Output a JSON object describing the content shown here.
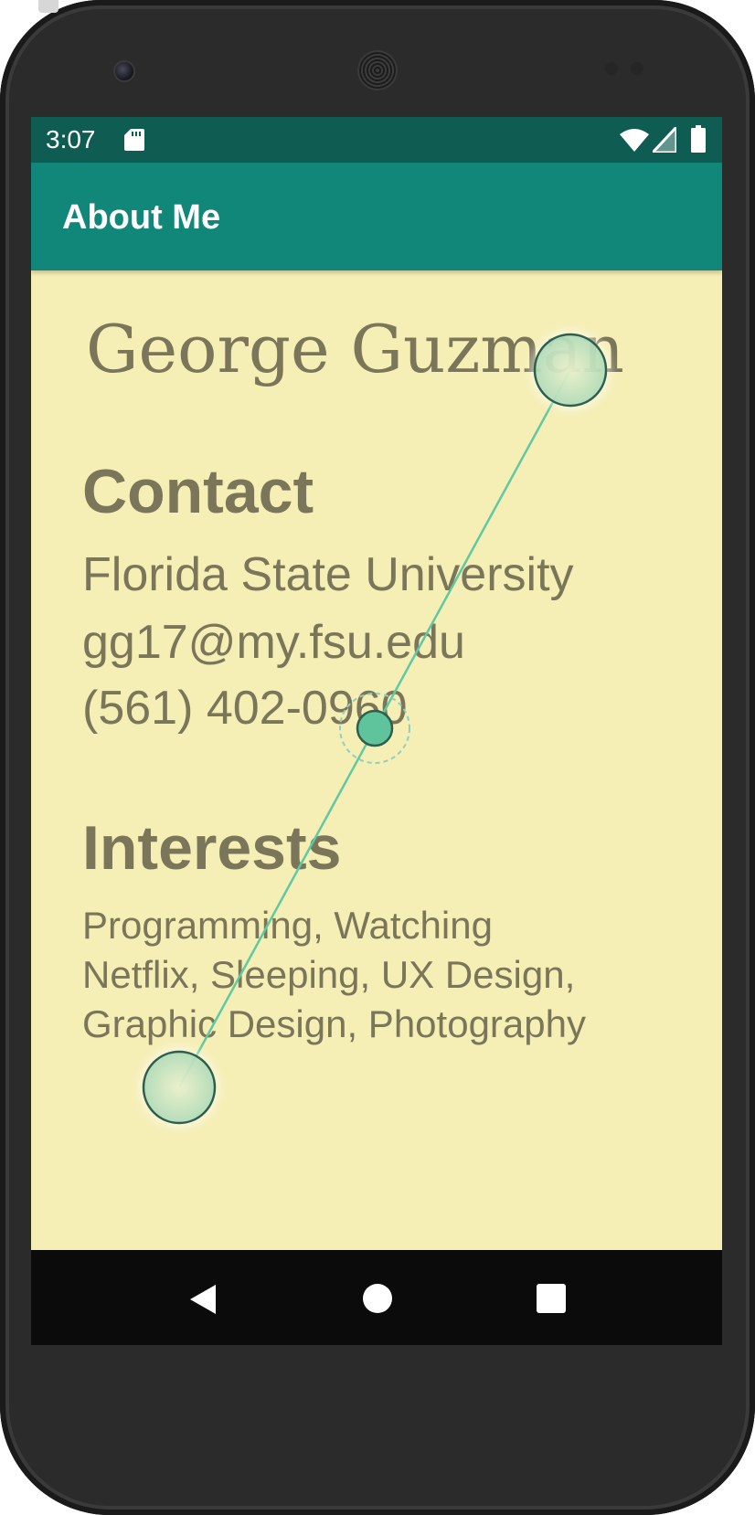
{
  "status_bar": {
    "time": "3:07",
    "icons": [
      "sd-card-icon",
      "wifi-icon",
      "cell-signal-icon",
      "battery-icon"
    ]
  },
  "app_bar": {
    "title": "About Me"
  },
  "profile": {
    "name": "George Guzman"
  },
  "contact": {
    "heading": "Contact",
    "school": "Florida State University",
    "email": "gg17@my.fsu.edu",
    "phone": "(561) 402-0960"
  },
  "interests": {
    "heading": "Interests",
    "text": "Programming, Watching Netflix, Sleeping, UX Design, Graphic Design, Photography"
  },
  "navigation": {
    "icons": [
      "back-icon",
      "home-icon",
      "recents-icon"
    ]
  },
  "colors": {
    "status_bar": "#0f5c52",
    "app_bar": "#11877a",
    "background": "#f5eeb5",
    "text": "#7b7559",
    "gesture": "#5fc9a3"
  }
}
